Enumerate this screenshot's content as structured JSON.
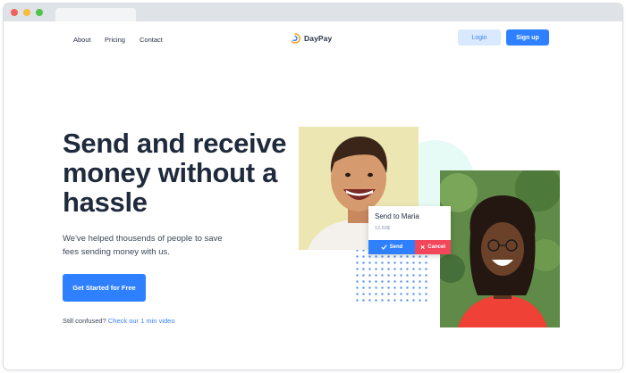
{
  "nav": {
    "links": [
      "About",
      "Pricing",
      "Contact"
    ],
    "brand": "DayPay",
    "login_label": "Login",
    "signup_label": "Sign up"
  },
  "hero": {
    "headline": "Send and receive money without a hassle",
    "subtext": "We've helped thousends of people to save fees sending money with us.",
    "cta_label": "Get Started for Free",
    "confused_prefix": "Still confused?",
    "video_link": "Check our 1 min video"
  },
  "card": {
    "title": "Send to Maria",
    "amount": "12,60$",
    "send_label": "Send",
    "cancel_label": "Cancel"
  },
  "icons": {
    "logo": "daypay-logo-icon",
    "send": "check-icon",
    "cancel": "x-icon"
  },
  "colors": {
    "primary": "#2f80ff",
    "primary_light": "#d9e9ff",
    "danger": "#f2465a",
    "heading": "#1f2a3c",
    "logo_orange": "#f5a623"
  }
}
